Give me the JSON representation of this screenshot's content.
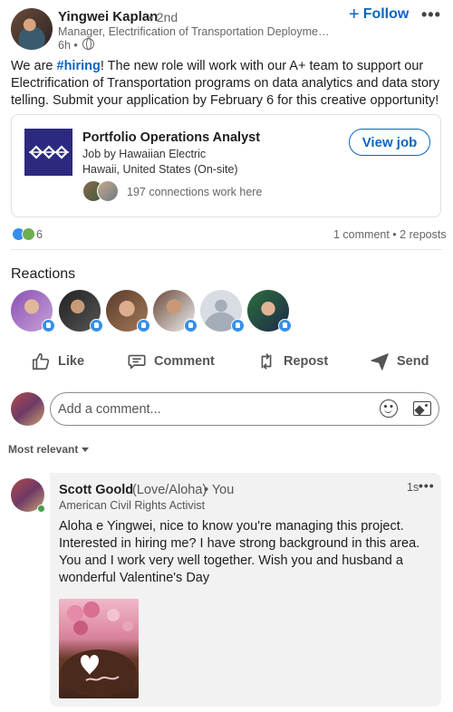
{
  "author": {
    "name": "Yingwei Kaplan",
    "degree": "• 2nd",
    "title": "Manager, Electrification of Transportation Deployment ...",
    "time": "6h •",
    "follow_label": "Follow",
    "follow_plus": "+"
  },
  "post": {
    "text_before": "We are ",
    "hashtag": "#hiring",
    "text_after": "! The new role will work with our A+ team to support our Electrification of Transportation programs on data analytics and data story telling. Submit your application by February 6 for this creative opportunity!"
  },
  "job": {
    "title": "Portfolio Operations Analyst",
    "company": "Job by Hawaiian Electric",
    "location": "Hawaii, United States (On-site)",
    "view_label": "View job",
    "connections": "197 connections work here"
  },
  "social": {
    "reaction_count": "6",
    "comment_repost": "1 comment • 2 reposts"
  },
  "reactions": {
    "heading": "Reactions",
    "reactor_count": 6
  },
  "actions": {
    "like": "Like",
    "comment": "Comment",
    "repost": "Repost",
    "send": "Send"
  },
  "comment_box": {
    "placeholder": "Add a comment..."
  },
  "sort": {
    "label": "Most relevant"
  },
  "comment": {
    "name": "Scott Goold",
    "pronunciation": "(Love/Aloha)",
    "you": "• You",
    "title": "American Civil Rights Activist",
    "time": "1s",
    "text": "Aloha e Yingwei, nice to know you're managing this project. Interested in hiring me? I have strong background in this area. You and I work very well together. Wish you and husband a wonderful Valentine's Day"
  },
  "colors": {
    "accent": "#0a66c2",
    "logo_bg": "#2c2a7e",
    "like_badge": "#378fe9",
    "online": "#44a048"
  }
}
